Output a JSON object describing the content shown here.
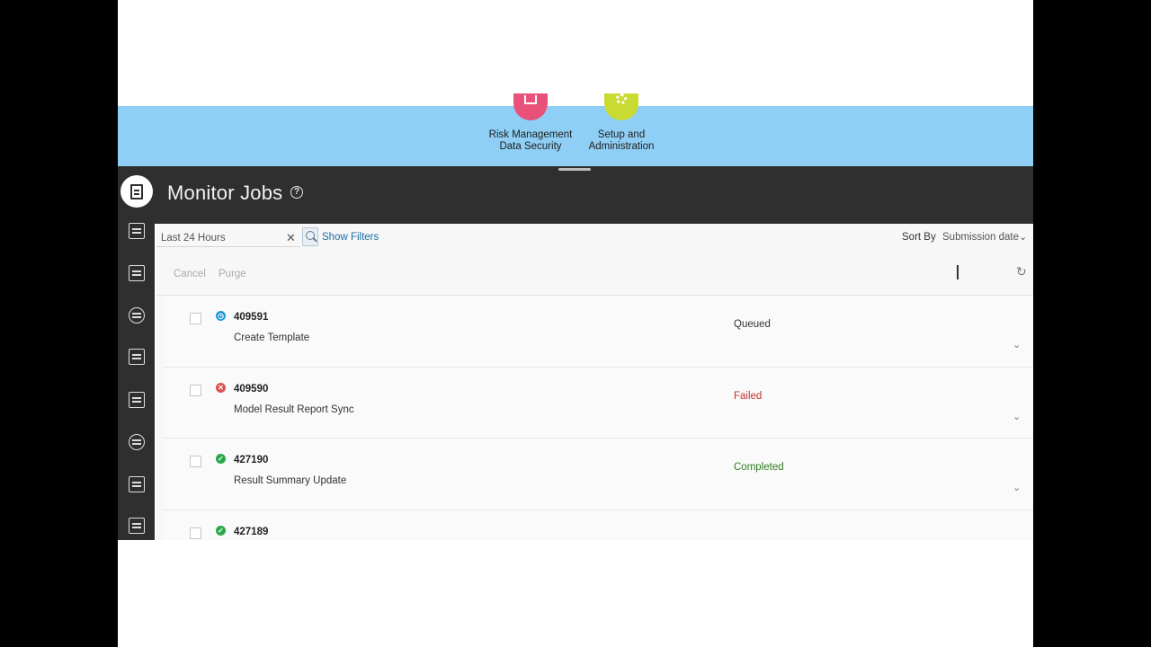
{
  "springboard": {
    "tiles": [
      {
        "label": "Risk Management\nData Security",
        "icon": "lock-icon",
        "color": "#e9517a"
      },
      {
        "label": "Setup and\nAdministration",
        "icon": "gear-icon",
        "color": "#c9da32"
      }
    ],
    "background": "#8fcff5"
  },
  "header": {
    "title": "Monitor Jobs",
    "help_glyph": "?"
  },
  "rail": {
    "items": [
      {
        "icon": "monitor-jobs-icon",
        "active": true
      },
      {
        "icon": "calendar-icon"
      },
      {
        "icon": "design-icon"
      },
      {
        "icon": "settings-icon"
      },
      {
        "icon": "users-icon"
      },
      {
        "icon": "tools-icon"
      },
      {
        "icon": "security-icon"
      },
      {
        "icon": "report-icon"
      },
      {
        "icon": "checklist-icon"
      }
    ]
  },
  "filters": {
    "time_range": "Last 24 Hours",
    "clear_glyph": "✕",
    "show_filters": "Show Filters",
    "sort_label": "Sort By",
    "sort_value": "Submission date"
  },
  "toolbar": {
    "cancel": "Cancel",
    "purge": "Purge"
  },
  "jobs": [
    {
      "id": "409591",
      "name": "Create Template",
      "status": "Queued",
      "status_color": "#333333",
      "icon_color": "#1b9ad6",
      "icon_glyph": "◷"
    },
    {
      "id": "409590",
      "name": "Model Result Report Sync",
      "status": "Failed",
      "status_color": "#c9302c",
      "icon_color": "#d9534f",
      "icon_glyph": "✕"
    },
    {
      "id": "427190",
      "name": "Result Summary Update",
      "status": "Completed",
      "status_color": "#2d7d1f",
      "icon_color": "#2aa84a",
      "icon_glyph": "✓"
    },
    {
      "id": "427189",
      "name": "",
      "status": "",
      "status_color": "#2d7d1f",
      "icon_color": "#2aa84a",
      "icon_glyph": "✓"
    }
  ]
}
